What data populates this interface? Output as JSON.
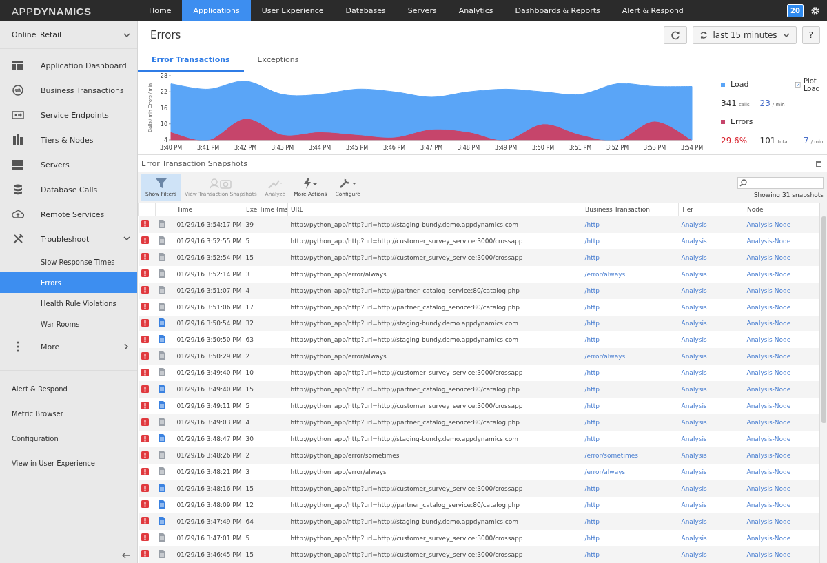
{
  "topbar": {
    "logo": "APP**DYNAMICS**",
    "nav": [
      {
        "label": "Home",
        "selected": false
      },
      {
        "label": "Applications",
        "selected": true
      },
      {
        "label": "User Experience",
        "selected": false
      },
      {
        "label": "Databases",
        "selected": false
      },
      {
        "label": "Servers",
        "selected": false
      },
      {
        "label": "Analytics",
        "selected": false
      },
      {
        "label": "Dashboards & Reports",
        "selected": false
      },
      {
        "label": "Alert & Respond",
        "selected": false
      }
    ],
    "badge": "20"
  },
  "sidebar": {
    "app": "Online_Retail",
    "items": [
      {
        "label": "Application Dashboard",
        "selected": false
      },
      {
        "label": "Business Transactions",
        "selected": false
      },
      {
        "label": "Service Endpoints",
        "selected": false
      },
      {
        "label": "Tiers & Nodes",
        "selected": false
      },
      {
        "label": "Servers",
        "selected": false
      },
      {
        "label": "Database Calls",
        "selected": false
      },
      {
        "label": "Remote Services",
        "selected": false
      },
      {
        "label": "Troubleshoot",
        "selected": false,
        "expanded": true,
        "children": [
          {
            "label": "Slow Response Times",
            "selected": false
          },
          {
            "label": "Errors",
            "selected": true
          },
          {
            "label": "Health Rule Violations",
            "selected": false
          },
          {
            "label": "War Rooms",
            "selected": false
          }
        ]
      },
      {
        "label": "More",
        "selected": false
      }
    ],
    "links": [
      "Alert & Respond",
      "Metric Browser",
      "Configuration",
      "View in User Experience"
    ]
  },
  "header": {
    "title": "Errors",
    "time_range": "last 15 minutes",
    "help": "?"
  },
  "tabs": [
    {
      "label": "Error Transactions",
      "selected": true
    },
    {
      "label": "Exceptions",
      "selected": false
    }
  ],
  "chart": {
    "chart_data": {
      "type": "area",
      "legend": "right",
      "ylabel": "Calls / min   Errors / min",
      "categories": [
        "3:40 PM",
        "3:41 PM",
        "3:42 PM",
        "3:43 PM",
        "3:44 PM",
        "3:45 PM",
        "3:46 PM",
        "3:47 PM",
        "3:48 PM",
        "3:49 PM",
        "3:50 PM",
        "3:51 PM",
        "3:52 PM",
        "3:53 PM",
        "3:54 PM"
      ],
      "ylim": [
        4,
        28
      ],
      "yticks": [
        4,
        10,
        16,
        22,
        28
      ],
      "series": [
        {
          "name": "Load",
          "color": "#5aa5f7",
          "values": [
            25,
            23,
            26,
            21,
            21,
            23,
            22,
            20,
            22,
            23,
            22,
            21,
            25,
            24,
            24
          ]
        },
        {
          "name": "Errors",
          "color": "#c6456b",
          "values": [
            7,
            4,
            12,
            6,
            7,
            6,
            5,
            8,
            7,
            4,
            10,
            6,
            4,
            11,
            4
          ]
        }
      ]
    },
    "legend": {
      "load": {
        "calls": "341",
        "calls_unit": "calls",
        "rate": "23",
        "rate_unit": "/ min"
      },
      "errors": {
        "percent": "29.6%",
        "total": "101",
        "total_unit": "total",
        "rate": "7",
        "rate_unit": "/ min"
      },
      "plot_load": {
        "label": "Plot Load",
        "checked": true
      }
    }
  },
  "snapshots": {
    "title": "Error Transaction Snapshots",
    "toolbar": [
      {
        "label": "Show Filters",
        "selected": true,
        "disabled": false
      },
      {
        "label": "View Transaction Snapshots",
        "selected": false,
        "disabled": true
      },
      {
        "label": "Analyze",
        "selected": false,
        "disabled": true
      },
      {
        "label": "More Actions",
        "selected": false,
        "disabled": false
      },
      {
        "label": "Configure",
        "selected": false,
        "disabled": false
      }
    ],
    "count": "Showing 31 snapshots",
    "columns": [
      "Time",
      "Exe Time (ms",
      "URL",
      "Business Transaction",
      "Tier",
      "Node"
    ],
    "rows": [
      {
        "kind": "partial",
        "time": "01/29/16 3:54:17 PM",
        "exe": "39",
        "url": "http://python_app/http?url=http://staging-bundy.demo.appdynamics.com",
        "bt": "/http",
        "tier": "Analysis",
        "node": "Analysis-Node"
      },
      {
        "kind": "partial",
        "time": "01/29/16 3:52:55 PM",
        "exe": "5",
        "url": "http://python_app/http?url=http://customer_survey_service:3000/crossapp",
        "bt": "/http",
        "tier": "Analysis",
        "node": "Analysis-Node"
      },
      {
        "kind": "partial",
        "time": "01/29/16 3:52:54 PM",
        "exe": "15",
        "url": "http://python_app/http?url=http://customer_survey_service:3000/crossapp",
        "bt": "/http",
        "tier": "Analysis",
        "node": "Analysis-Node"
      },
      {
        "kind": "partial",
        "time": "01/29/16 3:52:14 PM",
        "exe": "3",
        "url": "http://python_app/error/always",
        "bt": "/error/always",
        "tier": "Analysis",
        "node": "Analysis-Node"
      },
      {
        "kind": "partial",
        "time": "01/29/16 3:51:07 PM",
        "exe": "4",
        "url": "http://python_app/http?url=http://partner_catalog_service:80/catalog.php",
        "bt": "/http",
        "tier": "Analysis",
        "node": "Analysis-Node"
      },
      {
        "kind": "partial",
        "time": "01/29/16 3:51:06 PM",
        "exe": "17",
        "url": "http://python_app/http?url=http://partner_catalog_service:80/catalog.php",
        "bt": "/http",
        "tier": "Analysis",
        "node": "Analysis-Node"
      },
      {
        "kind": "full",
        "time": "01/29/16 3:50:54 PM",
        "exe": "32",
        "url": "http://python_app/http?url=http://staging-bundy.demo.appdynamics.com",
        "bt": "/http",
        "tier": "Analysis",
        "node": "Analysis-Node"
      },
      {
        "kind": "full",
        "time": "01/29/16 3:50:50 PM",
        "exe": "63",
        "url": "http://python_app/http?url=http://staging-bundy.demo.appdynamics.com",
        "bt": "/http",
        "tier": "Analysis",
        "node": "Analysis-Node"
      },
      {
        "kind": "partial",
        "time": "01/29/16 3:50:29 PM",
        "exe": "2",
        "url": "http://python_app/error/always",
        "bt": "/error/always",
        "tier": "Analysis",
        "node": "Analysis-Node"
      },
      {
        "kind": "partial",
        "time": "01/29/16 3:49:40 PM",
        "exe": "10",
        "url": "http://python_app/http?url=http://customer_survey_service:3000/crossapp",
        "bt": "/http",
        "tier": "Analysis",
        "node": "Analysis-Node"
      },
      {
        "kind": "full",
        "time": "01/29/16 3:49:40 PM",
        "exe": "15",
        "url": "http://python_app/http?url=http://partner_catalog_service:80/catalog.php",
        "bt": "/http",
        "tier": "Analysis",
        "node": "Analysis-Node"
      },
      {
        "kind": "full",
        "time": "01/29/16 3:49:11 PM",
        "exe": "5",
        "url": "http://python_app/http?url=http://customer_survey_service:3000/crossapp",
        "bt": "/http",
        "tier": "Analysis",
        "node": "Analysis-Node"
      },
      {
        "kind": "partial",
        "time": "01/29/16 3:49:03 PM",
        "exe": "4",
        "url": "http://python_app/http?url=http://partner_catalog_service:80/catalog.php",
        "bt": "/http",
        "tier": "Analysis",
        "node": "Analysis-Node"
      },
      {
        "kind": "full",
        "time": "01/29/16 3:48:47 PM",
        "exe": "30",
        "url": "http://python_app/http?url=http://staging-bundy.demo.appdynamics.com",
        "bt": "/http",
        "tier": "Analysis",
        "node": "Analysis-Node"
      },
      {
        "kind": "partial",
        "time": "01/29/16 3:48:26 PM",
        "exe": "2",
        "url": "http://python_app/error/sometimes",
        "bt": "/error/sometimes",
        "tier": "Analysis",
        "node": "Analysis-Node"
      },
      {
        "kind": "partial",
        "time": "01/29/16 3:48:21 PM",
        "exe": "3",
        "url": "http://python_app/error/always",
        "bt": "/error/always",
        "tier": "Analysis",
        "node": "Analysis-Node"
      },
      {
        "kind": "full",
        "time": "01/29/16 3:48:16 PM",
        "exe": "15",
        "url": "http://python_app/http?url=http://customer_survey_service:3000/crossapp",
        "bt": "/http",
        "tier": "Analysis",
        "node": "Analysis-Node"
      },
      {
        "kind": "full",
        "time": "01/29/16 3:48:09 PM",
        "exe": "12",
        "url": "http://python_app/http?url=http://partner_catalog_service:80/catalog.php",
        "bt": "/http",
        "tier": "Analysis",
        "node": "Analysis-Node"
      },
      {
        "kind": "full",
        "time": "01/29/16 3:47:49 PM",
        "exe": "64",
        "url": "http://python_app/http?url=http://staging-bundy.demo.appdynamics.com",
        "bt": "/http",
        "tier": "Analysis",
        "node": "Analysis-Node"
      },
      {
        "kind": "partial",
        "time": "01/29/16 3:47:01 PM",
        "exe": "5",
        "url": "http://python_app/http?url=http://customer_survey_service:3000/crossapp",
        "bt": "/http",
        "tier": "Analysis",
        "node": "Analysis-Node"
      },
      {
        "kind": "partial",
        "time": "01/29/16 3:46:45 PM",
        "exe": "15",
        "url": "http://python_app/http?url=http://customer_survey_service:3000/crossapp",
        "bt": "/http",
        "tier": "Analysis",
        "node": "Analysis-Node"
      }
    ]
  }
}
